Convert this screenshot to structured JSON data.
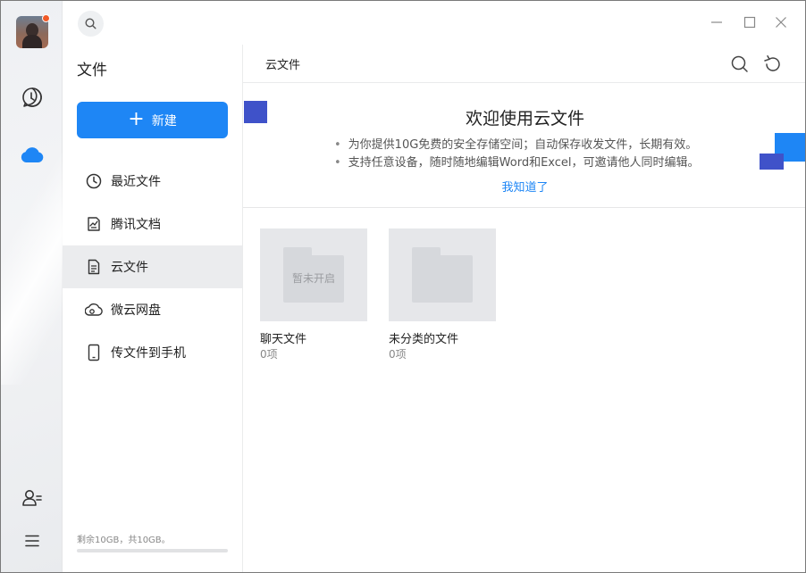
{
  "app": {
    "rail": {
      "avatar_icon": "user-avatar",
      "notification_color": "#f05a28",
      "items": [
        {
          "icon": "chat-bubble-icon"
        },
        {
          "icon": "cloud-icon",
          "active": true
        },
        {
          "icon": "contacts-icon"
        },
        {
          "icon": "menu-icon"
        }
      ]
    },
    "titlebar": {
      "search_icon": "search-icon",
      "controls": [
        "minimize-icon",
        "maximize-icon",
        "close-icon"
      ]
    }
  },
  "sidebar": {
    "title": "文件",
    "new_button": {
      "label": "新建",
      "icon": "plus-icon",
      "color": "#1e86f5"
    },
    "items": [
      {
        "label": "最近文件",
        "icon": "clock-icon"
      },
      {
        "label": "腾讯文档",
        "icon": "tencent-doc-icon"
      },
      {
        "label": "云文件",
        "icon": "document-icon",
        "active": true
      },
      {
        "label": "微云网盘",
        "icon": "weiyun-cloud-icon"
      },
      {
        "label": "传文件到手机",
        "icon": "phone-icon"
      }
    ],
    "storage": {
      "text": "剩余10GB，共10GB。",
      "used_fraction": 0
    }
  },
  "main": {
    "breadcrumb": "云文件",
    "toolbar": {
      "search_icon": "search-icon",
      "refresh_icon": "refresh-icon"
    },
    "banner": {
      "title": "欢迎使用云文件",
      "lines": [
        "为你提供10G免费的安全存储空间；自动保存收发文件，长期有效。",
        "支持任意设备，随时随地编辑Word和Excel，可邀请他人同时编辑。"
      ],
      "link": "我知道了",
      "accent_colors": [
        "#3f52c9",
        "#1e86f5"
      ]
    },
    "folders": [
      {
        "name": "聊天文件",
        "count": "0项",
        "overlay": "暂未开启"
      },
      {
        "name": "未分类的文件",
        "count": "0项",
        "overlay": ""
      }
    ]
  }
}
